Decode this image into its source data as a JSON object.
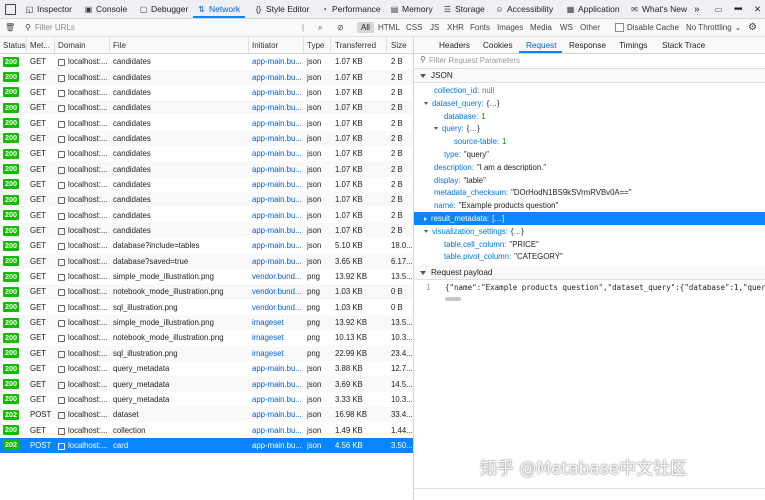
{
  "toolbar": {
    "tabs": [
      {
        "label": "Inspector",
        "icon": "inspector-icon"
      },
      {
        "label": "Console",
        "icon": "console-icon"
      },
      {
        "label": "Debugger",
        "icon": "debugger-icon"
      },
      {
        "label": "Network",
        "icon": "network-icon"
      },
      {
        "label": "Style Editor",
        "icon": "style-editor-icon"
      },
      {
        "label": "Performance",
        "icon": "performance-icon"
      },
      {
        "label": "Memory",
        "icon": "memory-icon"
      },
      {
        "label": "Storage",
        "icon": "storage-icon"
      },
      {
        "label": "Accessibility",
        "icon": "accessibility-icon"
      },
      {
        "label": "Application",
        "icon": "application-icon"
      },
      {
        "label": "What's New",
        "icon": "whats-new-icon"
      }
    ],
    "active_tab": "Network"
  },
  "filter": {
    "placeholder": "Filter URLs",
    "types": [
      "All",
      "HTML",
      "CSS",
      "JS",
      "XHR",
      "Fonts",
      "Images",
      "Media",
      "WS",
      "Other"
    ],
    "disable_cache_label": "Disable Cache",
    "throttling_label": "No Throttling"
  },
  "table": {
    "columns": [
      "Status",
      "Met...",
      "Domain",
      "File",
      "Initiator",
      "Type",
      "Transferred",
      "Size"
    ],
    "rows": [
      {
        "status": "200",
        "method": "GET",
        "domain": "localhost:...",
        "file": "candidates",
        "initiator": "app-main.bu...",
        "type": "json",
        "transferred": "1.07 KB",
        "size": "2 B"
      },
      {
        "status": "200",
        "method": "GET",
        "domain": "localhost:...",
        "file": "candidates",
        "initiator": "app-main.bu...",
        "type": "json",
        "transferred": "1.07 KB",
        "size": "2 B"
      },
      {
        "status": "200",
        "method": "GET",
        "domain": "localhost:...",
        "file": "candidates",
        "initiator": "app-main.bu...",
        "type": "json",
        "transferred": "1.07 KB",
        "size": "2 B"
      },
      {
        "status": "200",
        "method": "GET",
        "domain": "localhost:...",
        "file": "candidates",
        "initiator": "app-main.bu...",
        "type": "json",
        "transferred": "1.07 KB",
        "size": "2 B"
      },
      {
        "status": "200",
        "method": "GET",
        "domain": "localhost:...",
        "file": "candidates",
        "initiator": "app-main.bu...",
        "type": "json",
        "transferred": "1.07 KB",
        "size": "2 B"
      },
      {
        "status": "200",
        "method": "GET",
        "domain": "localhost:...",
        "file": "candidates",
        "initiator": "app-main.bu...",
        "type": "json",
        "transferred": "1.07 KB",
        "size": "2 B"
      },
      {
        "status": "200",
        "method": "GET",
        "domain": "localhost:...",
        "file": "candidates",
        "initiator": "app-main.bu...",
        "type": "json",
        "transferred": "1.07 KB",
        "size": "2 B"
      },
      {
        "status": "200",
        "method": "GET",
        "domain": "localhost:...",
        "file": "candidates",
        "initiator": "app-main.bu...",
        "type": "json",
        "transferred": "1.07 KB",
        "size": "2 B"
      },
      {
        "status": "200",
        "method": "GET",
        "domain": "localhost:...",
        "file": "candidates",
        "initiator": "app-main.bu...",
        "type": "json",
        "transferred": "1.07 KB",
        "size": "2 B"
      },
      {
        "status": "200",
        "method": "GET",
        "domain": "localhost:...",
        "file": "candidates",
        "initiator": "app-main.bu...",
        "type": "json",
        "transferred": "1.07 KB",
        "size": "2 B"
      },
      {
        "status": "200",
        "method": "GET",
        "domain": "localhost:...",
        "file": "candidates",
        "initiator": "app-main.bu...",
        "type": "json",
        "transferred": "1.07 KB",
        "size": "2 B"
      },
      {
        "status": "200",
        "method": "GET",
        "domain": "localhost:...",
        "file": "candidates",
        "initiator": "app-main.bu...",
        "type": "json",
        "transferred": "1.07 KB",
        "size": "2 B"
      },
      {
        "status": "200",
        "method": "GET",
        "domain": "localhost:...",
        "file": "database?include=tables",
        "initiator": "app-main.bu...",
        "type": "json",
        "transferred": "5.10 KB",
        "size": "18.0..."
      },
      {
        "status": "200",
        "method": "GET",
        "domain": "localhost:...",
        "file": "database?saved=true",
        "initiator": "app-main.bu...",
        "type": "json",
        "transferred": "3.65 KB",
        "size": "6.17..."
      },
      {
        "status": "200",
        "method": "GET",
        "domain": "localhost:...",
        "file": "simple_mode_illustration.png",
        "initiator": "vendor.bund...",
        "type": "png",
        "transferred": "13.92 KB",
        "size": "13.5..."
      },
      {
        "status": "200",
        "method": "GET",
        "domain": "localhost:...",
        "file": "notebook_mode_illustration.png",
        "initiator": "vendor.bund...",
        "type": "png",
        "transferred": "1.03 KB",
        "size": "0 B"
      },
      {
        "status": "200",
        "method": "GET",
        "domain": "localhost:...",
        "file": "sql_illustration.png",
        "initiator": "vendor.bund...",
        "type": "png",
        "transferred": "1.03 KB",
        "size": "0 B"
      },
      {
        "status": "200",
        "method": "GET",
        "domain": "localhost:...",
        "file": "simple_mode_illustration.png",
        "initiator": "imageset",
        "type": "png",
        "transferred": "13.92 KB",
        "size": "13.5..."
      },
      {
        "status": "200",
        "method": "GET",
        "domain": "localhost:...",
        "file": "notebook_mode_illustration.png",
        "initiator": "imageset",
        "type": "png",
        "transferred": "10.13 KB",
        "size": "10.3..."
      },
      {
        "status": "200",
        "method": "GET",
        "domain": "localhost:...",
        "file": "sql_illustration.png",
        "initiator": "imageset",
        "type": "png",
        "transferred": "22.99 KB",
        "size": "23.4..."
      },
      {
        "status": "200",
        "method": "GET",
        "domain": "localhost:...",
        "file": "query_metadata",
        "initiator": "app-main.bu...",
        "type": "json",
        "transferred": "3.88 KB",
        "size": "12.7..."
      },
      {
        "status": "200",
        "method": "GET",
        "domain": "localhost:...",
        "file": "query_metadata",
        "initiator": "app-main.bu...",
        "type": "json",
        "transferred": "3.69 KB",
        "size": "14.5..."
      },
      {
        "status": "200",
        "method": "GET",
        "domain": "localhost:...",
        "file": "query_metadata",
        "initiator": "app-main.bu...",
        "type": "json",
        "transferred": "3.33 KB",
        "size": "10.3..."
      },
      {
        "status": "202",
        "method": "POST",
        "domain": "localhost:...",
        "file": "dataset",
        "initiator": "app-main.bu...",
        "type": "json",
        "transferred": "16.98 KB",
        "size": "33.4..."
      },
      {
        "status": "200",
        "method": "GET",
        "domain": "localhost:...",
        "file": "collection",
        "initiator": "app-main.bu...",
        "type": "json",
        "transferred": "1.49 KB",
        "size": "1.44..."
      },
      {
        "status": "202",
        "method": "POST",
        "domain": "localhost:...",
        "file": "card",
        "initiator": "app-main.bu...",
        "type": "json",
        "transferred": "4.56 KB",
        "size": "3.50..."
      }
    ],
    "selected_index": 25
  },
  "details": {
    "tabs": [
      "Headers",
      "Cookies",
      "Request",
      "Response",
      "Timings",
      "Stack Trace"
    ],
    "active_tab": "Request",
    "filter_placeholder": "Filter Request Parameters",
    "json_section_label": "JSON",
    "json_lines": [
      {
        "key": "collection_id:",
        "value": "null",
        "vclass": "null",
        "indent": 0,
        "toggle": ""
      },
      {
        "key": "dataset_query:",
        "value": "{…}",
        "vclass": "v",
        "indent": 0,
        "toggle": "down"
      },
      {
        "key": "database:",
        "value": "1",
        "vclass": "num",
        "indent": 1,
        "toggle": ""
      },
      {
        "key": "query:",
        "value": "{…}",
        "vclass": "v",
        "indent": 1,
        "toggle": "down"
      },
      {
        "key": "source-table:",
        "value": "1",
        "vclass": "num",
        "indent": 2,
        "toggle": ""
      },
      {
        "key": "type:",
        "value": "\"query\"",
        "vclass": "v",
        "indent": 1,
        "toggle": ""
      },
      {
        "key": "description:",
        "value": "\"I am a description.\"",
        "vclass": "v",
        "indent": 0,
        "toggle": ""
      },
      {
        "key": "display:",
        "value": "\"table\"",
        "vclass": "v",
        "indent": 0,
        "toggle": ""
      },
      {
        "key": "metadata_checksum:",
        "value": "\"DOrHodN1BS9kSVrmRVBv0A==\"",
        "vclass": "v",
        "indent": 0,
        "toggle": ""
      },
      {
        "key": "name:",
        "value": "\"Example products question\"",
        "vclass": "v",
        "indent": 0,
        "toggle": ""
      },
      {
        "key": "result_metadata:",
        "value": "[…]",
        "vclass": "v",
        "indent": 0,
        "toggle": "right"
      },
      {
        "key": "visualization_settings:",
        "value": "{…}",
        "vclass": "v",
        "indent": 0,
        "toggle": "down"
      },
      {
        "key": "table.cell_column:",
        "value": "\"PRICE\"",
        "vclass": "v",
        "indent": 1,
        "toggle": ""
      },
      {
        "key": "table.pivot_column:",
        "value": "\"CATEGORY\"",
        "vclass": "v",
        "indent": 1,
        "toggle": ""
      }
    ],
    "json_selected_index": 10,
    "payload_section_label": "Request payload",
    "payload_line_number": "1",
    "payload_text": "{\"name\":\"Example products question\",\"dataset_query\":{\"database\":1,\"query\":{\"sou"
  },
  "watermark": "知乎 @Metabase中文社区",
  "colors": {
    "accent": "#0a84ff",
    "status_ok": "#12bc00",
    "link": "#0060df"
  }
}
